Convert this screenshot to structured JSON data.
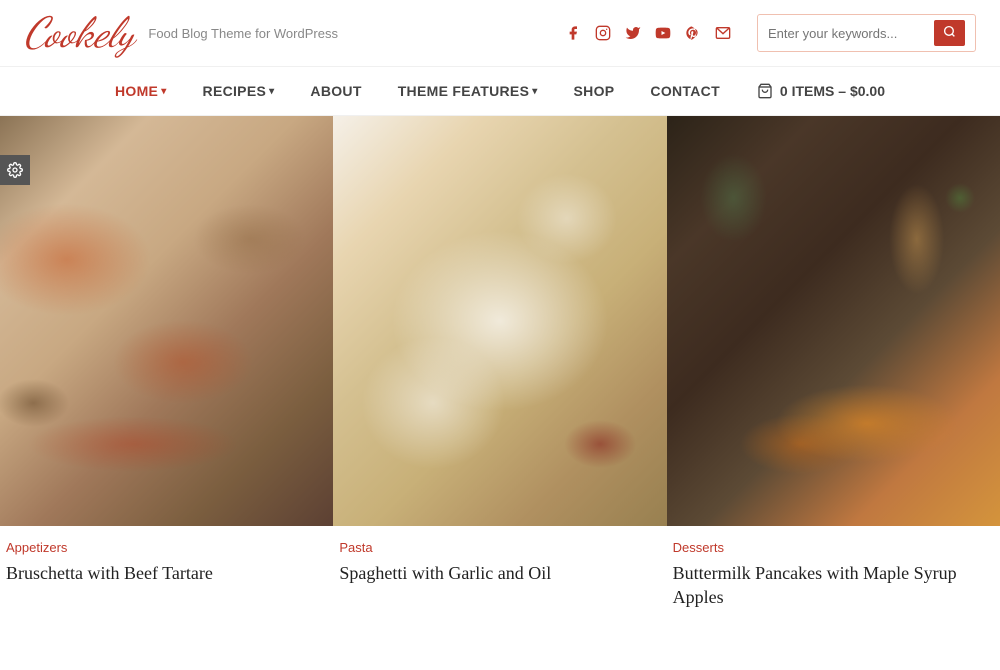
{
  "site": {
    "logo": "Cookely",
    "tagline": "Food Blog Theme for WordPress"
  },
  "social": {
    "icons": [
      {
        "name": "facebook-icon",
        "symbol": "f"
      },
      {
        "name": "instagram-icon",
        "symbol": "📷"
      },
      {
        "name": "twitter-icon",
        "symbol": "🐦"
      },
      {
        "name": "youtube-icon",
        "symbol": "▶"
      },
      {
        "name": "pinterest-icon",
        "symbol": "P"
      },
      {
        "name": "email-icon",
        "symbol": "✉"
      }
    ]
  },
  "search": {
    "placeholder": "Enter your keywords...",
    "button_label": "🔍"
  },
  "nav": {
    "items": [
      {
        "label": "HOME",
        "active": true,
        "has_dropdown": true
      },
      {
        "label": "RECIPES",
        "active": false,
        "has_dropdown": true
      },
      {
        "label": "ABOUT",
        "active": false,
        "has_dropdown": false
      },
      {
        "label": "THEME FEATURES",
        "active": false,
        "has_dropdown": true
      },
      {
        "label": "SHOP",
        "active": false,
        "has_dropdown": false
      },
      {
        "label": "CONTACT",
        "active": false,
        "has_dropdown": false
      }
    ],
    "cart_label": "0 ITEMS – $0.00"
  },
  "cards": [
    {
      "category": "Appetizers",
      "title": "Bruschetta with Beef Tartare",
      "image_class": "img-bruschetta"
    },
    {
      "category": "Pasta",
      "title": "Spaghetti with Garlic and Oil",
      "image_class": "img-spaghetti"
    },
    {
      "category": "Desserts",
      "title": "Buttermilk Pancakes with Maple Syrup Apples",
      "image_class": "img-pancakes"
    }
  ],
  "gear": {
    "label": "⚙"
  }
}
